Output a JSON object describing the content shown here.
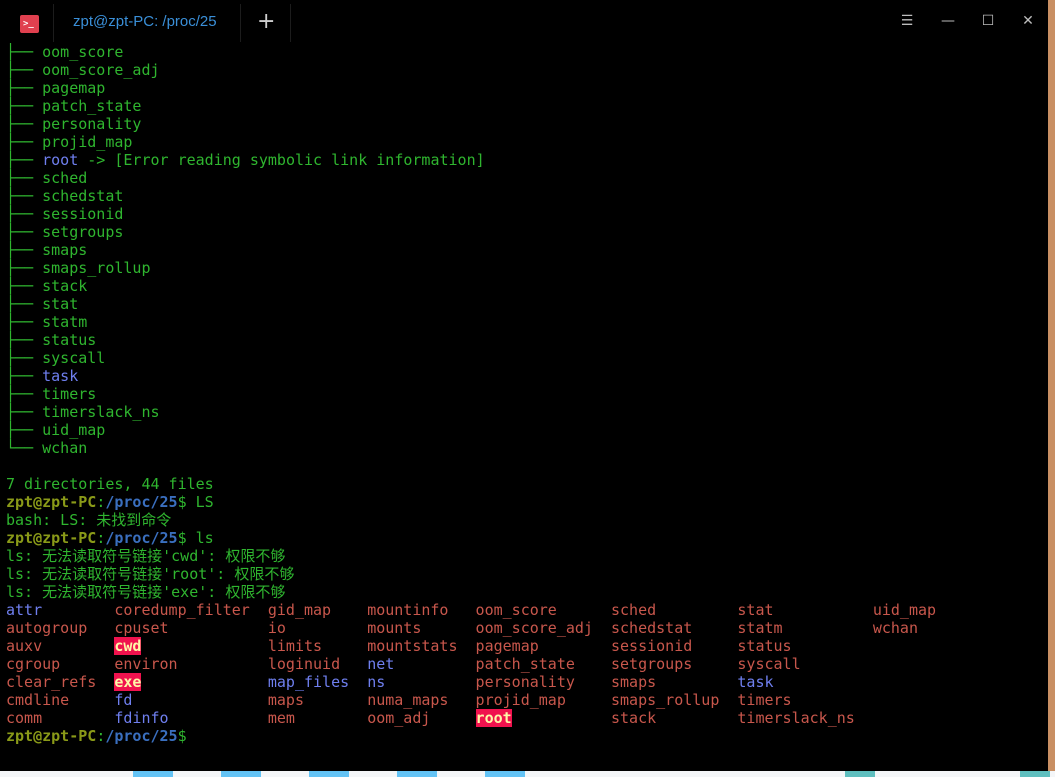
{
  "window": {
    "tab_title": "zpt@zpt-PC: /proc/25",
    "app_icon": "terminal-icon",
    "new_tab": "+",
    "controls": [
      "menu-icon",
      "minimize-icon",
      "maximize-icon",
      "close-icon"
    ]
  },
  "colors": {
    "green": "#2fb52f",
    "dir_blue": "#6f7fef",
    "file_red": "#c8574c",
    "link_bg": "#f0124e",
    "prompt_user": "#8a9a18",
    "prompt_path": "#3a6fbf"
  },
  "tree_prefix": "├── ",
  "tree_last_prefix": "└── ",
  "tree": [
    {
      "name": "oom_score",
      "type": "file"
    },
    {
      "name": "oom_score_adj",
      "type": "file"
    },
    {
      "name": "pagemap",
      "type": "file"
    },
    {
      "name": "patch_state",
      "type": "file"
    },
    {
      "name": "personality",
      "type": "file"
    },
    {
      "name": "projid_map",
      "type": "file"
    },
    {
      "name": "root",
      "type": "dir",
      "suffix": " -> [Error reading symbolic link information]"
    },
    {
      "name": "sched",
      "type": "file"
    },
    {
      "name": "schedstat",
      "type": "file"
    },
    {
      "name": "sessionid",
      "type": "file"
    },
    {
      "name": "setgroups",
      "type": "file"
    },
    {
      "name": "smaps",
      "type": "file"
    },
    {
      "name": "smaps_rollup",
      "type": "file"
    },
    {
      "name": "stack",
      "type": "file"
    },
    {
      "name": "stat",
      "type": "file"
    },
    {
      "name": "statm",
      "type": "file"
    },
    {
      "name": "status",
      "type": "file"
    },
    {
      "name": "syscall",
      "type": "file"
    },
    {
      "name": "task",
      "type": "dir"
    },
    {
      "name": "timers",
      "type": "file"
    },
    {
      "name": "timerslack_ns",
      "type": "file"
    },
    {
      "name": "uid_map",
      "type": "file"
    },
    {
      "name": "wchan",
      "type": "file"
    }
  ],
  "summary": "7 directories, 44 files",
  "prompt": {
    "user": "zpt@zpt-PC",
    "sep": ":",
    "path": "/proc/25",
    "dollar": "$"
  },
  "cmd1": " LS",
  "cmd1_error": "bash: LS: 未找到命令",
  "cmd2": " ls",
  "ls_errors": [
    "ls: 无法读取符号链接'cwd': 权限不够",
    "ls: 无法读取符号链接'root': 权限不够",
    "ls: 无法读取符号链接'exe': 权限不够"
  ],
  "ls_columns": [
    [
      {
        "n": "attr",
        "t": "dir"
      },
      {
        "n": "autogroup",
        "t": "file"
      },
      {
        "n": "auxv",
        "t": "file"
      },
      {
        "n": "cgroup",
        "t": "file"
      },
      {
        "n": "clear_refs",
        "t": "file"
      },
      {
        "n": "cmdline",
        "t": "file"
      },
      {
        "n": "comm",
        "t": "file"
      }
    ],
    [
      {
        "n": "coredump_filter",
        "t": "file"
      },
      {
        "n": "cpuset",
        "t": "file"
      },
      {
        "n": "cwd",
        "t": "link"
      },
      {
        "n": "environ",
        "t": "file"
      },
      {
        "n": "exe",
        "t": "link"
      },
      {
        "n": "fd",
        "t": "dir"
      },
      {
        "n": "fdinfo",
        "t": "dir"
      }
    ],
    [
      {
        "n": "gid_map",
        "t": "file"
      },
      {
        "n": "io",
        "t": "file"
      },
      {
        "n": "limits",
        "t": "file"
      },
      {
        "n": "loginuid",
        "t": "file"
      },
      {
        "n": "map_files",
        "t": "dir"
      },
      {
        "n": "maps",
        "t": "file"
      },
      {
        "n": "mem",
        "t": "file"
      }
    ],
    [
      {
        "n": "mountinfo",
        "t": "file"
      },
      {
        "n": "mounts",
        "t": "file"
      },
      {
        "n": "mountstats",
        "t": "file"
      },
      {
        "n": "net",
        "t": "dir"
      },
      {
        "n": "ns",
        "t": "dir"
      },
      {
        "n": "numa_maps",
        "t": "file"
      },
      {
        "n": "oom_adj",
        "t": "file"
      }
    ],
    [
      {
        "n": "oom_score",
        "t": "file"
      },
      {
        "n": "oom_score_adj",
        "t": "file"
      },
      {
        "n": "pagemap",
        "t": "file"
      },
      {
        "n": "patch_state",
        "t": "file"
      },
      {
        "n": "personality",
        "t": "file"
      },
      {
        "n": "projid_map",
        "t": "file"
      },
      {
        "n": "root",
        "t": "link"
      }
    ],
    [
      {
        "n": "sched",
        "t": "file"
      },
      {
        "n": "schedstat",
        "t": "file"
      },
      {
        "n": "sessionid",
        "t": "file"
      },
      {
        "n": "setgroups",
        "t": "file"
      },
      {
        "n": "smaps",
        "t": "file"
      },
      {
        "n": "smaps_rollup",
        "t": "file"
      },
      {
        "n": "stack",
        "t": "file"
      }
    ],
    [
      {
        "n": "stat",
        "t": "file"
      },
      {
        "n": "statm",
        "t": "file"
      },
      {
        "n": "status",
        "t": "file"
      },
      {
        "n": "syscall",
        "t": "file"
      },
      {
        "n": "task",
        "t": "dir"
      },
      {
        "n": "timers",
        "t": "file"
      },
      {
        "n": "timerslack_ns",
        "t": "file"
      }
    ],
    [
      {
        "n": "uid_map",
        "t": "file"
      },
      {
        "n": "wchan",
        "t": "file"
      }
    ]
  ]
}
